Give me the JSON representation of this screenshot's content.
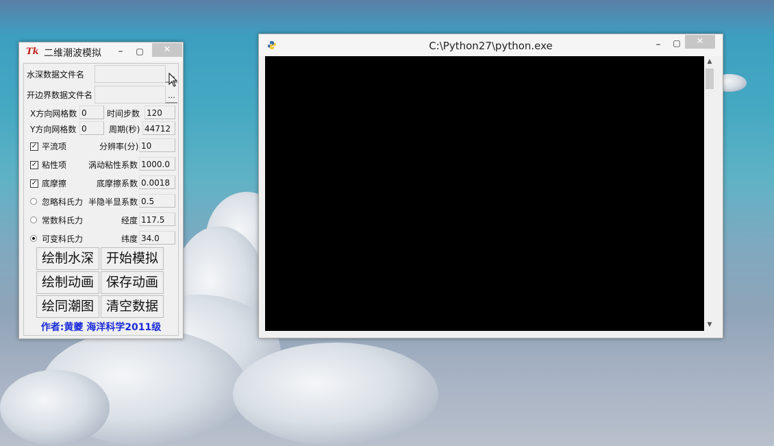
{
  "tk_window": {
    "logo": "Tk",
    "title": "二维潮波模拟",
    "minimize": "–",
    "maximize": "▢",
    "close": "✕",
    "file_fields": [
      {
        "label": "水深数据文件名",
        "value": "",
        "browse": "..."
      },
      {
        "label": "开边界数据文件名",
        "value": "",
        "browse": "..."
      }
    ],
    "grid_params": {
      "x_label": "X方向网格数",
      "x_value": "0",
      "y_label": "Y方向网格数",
      "y_value": "0",
      "steps_label": "时间步数",
      "steps_value": "120",
      "period_label": "周期(秒)",
      "period_value": "44712"
    },
    "options": [
      {
        "label": "平流项",
        "checked": true,
        "param_label": "分辨率(分)",
        "param_value": "10"
      },
      {
        "label": "粘性项",
        "checked": true,
        "param_label": "涡动粘性系数",
        "param_value": "1000.0"
      },
      {
        "label": "底摩擦",
        "checked": true,
        "param_label": "底摩擦系数",
        "param_value": "0.0018"
      }
    ],
    "coriolis": [
      {
        "label": "忽略科氏力",
        "selected": false,
        "param_label": "半隐半显系数",
        "param_value": "0.5"
      },
      {
        "label": "常数科氏力",
        "selected": false,
        "param_label": "经度",
        "param_value": "117.5"
      },
      {
        "label": "可变科氏力",
        "selected": true,
        "param_label": "纬度",
        "param_value": "34.0"
      }
    ],
    "buttons": {
      "draw_depth": "绘制水深",
      "start_sim": "开始模拟",
      "draw_anim": "绘制动画",
      "save_anim": "保存动画",
      "draw_cotidal": "绘同潮图",
      "clear_data": "清空数据"
    },
    "author": "作者:黄夔  海洋科学2011级"
  },
  "py_window": {
    "title": "C:\\Python27\\python.exe",
    "minimize": "–",
    "maximize": "▢",
    "close": "✕",
    "scroll_up": "▲",
    "scroll_down": "▼"
  },
  "colors": {
    "author_text": "#1a2bd8",
    "console_bg": "#000000",
    "tk_logo": "#c0201a"
  },
  "icons": {
    "tk_logo": "tk-feather-icon",
    "python": "python-icon",
    "cursor": "mouse-pointer-icon"
  }
}
